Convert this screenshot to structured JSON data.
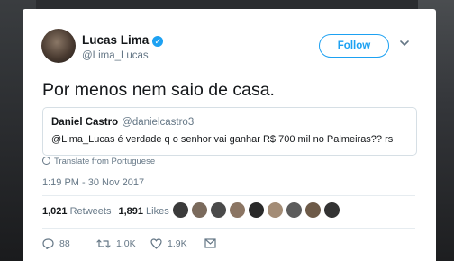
{
  "tweet": {
    "author_name": "Lucas Lima",
    "author_handle": "@Lima_Lucas",
    "follow_label": "Follow",
    "text": "Por menos nem saio de casa.",
    "quoted": {
      "name": "Daniel Castro",
      "handle": "@danielcastro3",
      "text": "@Lima_Lucas é verdade q o senhor vai ganhar R$ 700 mil no Palmeiras?? rs"
    },
    "translate_label": "Translate from Portuguese",
    "timestamp": "1:19 PM - 30 Nov 2017",
    "retweets_count": "1,021",
    "retweets_label": "Retweets",
    "likes_count": "1,891",
    "likes_label": "Likes",
    "actions": {
      "replies": "88",
      "retweets": "1.0K",
      "likes": "1.9K"
    }
  },
  "colors": {
    "accent": "#1da1f2",
    "secondary_text": "#657786",
    "primary_text": "#14171a"
  }
}
